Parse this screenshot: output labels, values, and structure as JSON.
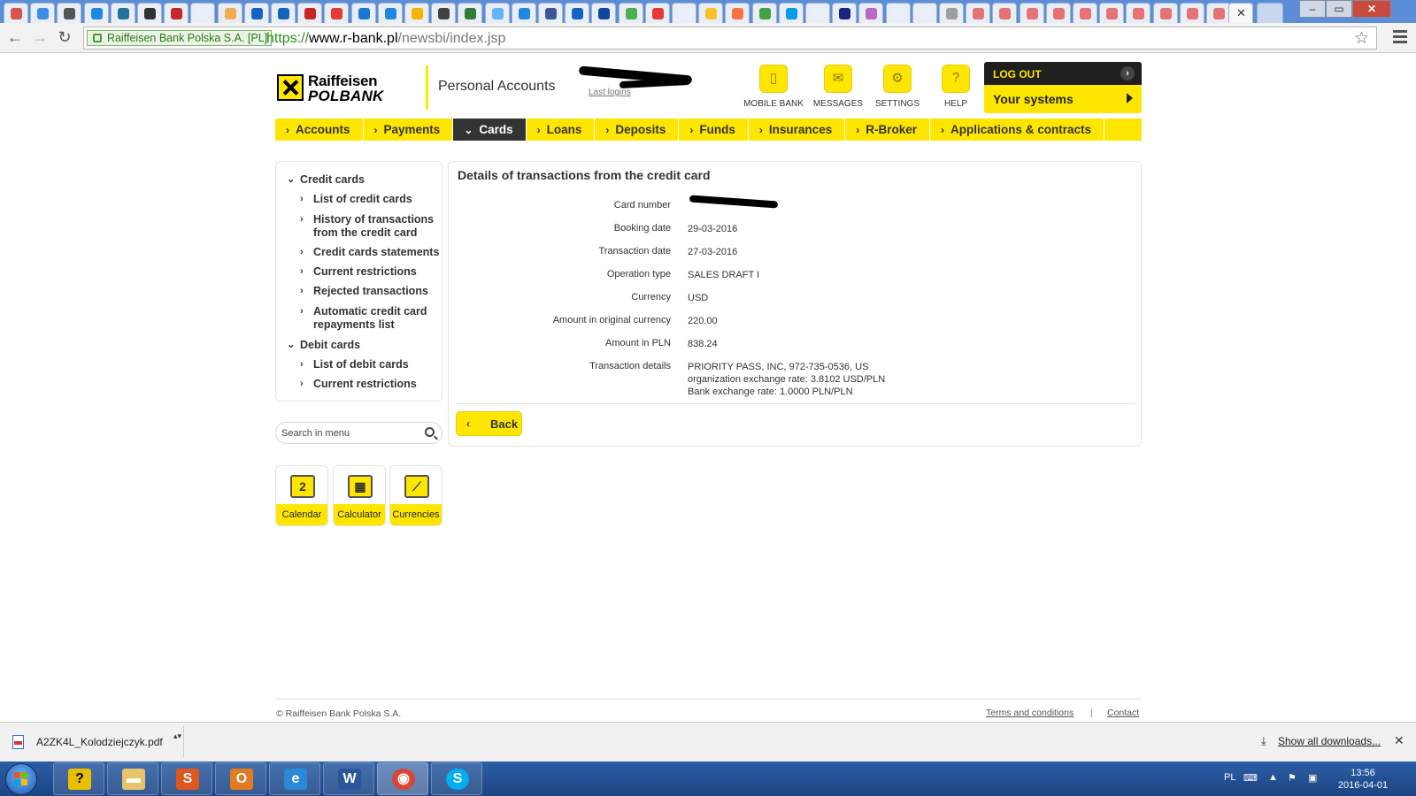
{
  "browser": {
    "ev_label": "Raiffeisen Bank Polska S.A. [PL]",
    "url_scheme": "https://",
    "url_host": "www.r-bank.pl",
    "url_path": "/newsbi/index.jsp",
    "tab_close": "✕"
  },
  "header": {
    "logo_line1": "Raiffeisen",
    "logo_line2": "POLBANK",
    "section_title": "Personal Accounts",
    "last_logins": "Last logins",
    "icons": [
      {
        "label": "MOBILE BANK",
        "icon": "mobile-icon"
      },
      {
        "label": "MESSAGES",
        "icon": "envelope-icon"
      },
      {
        "label": "SETTINGS",
        "icon": "gear-icon"
      },
      {
        "label": "HELP",
        "icon": "help-icon"
      }
    ],
    "logout": "LOG OUT",
    "your_systems": "Your systems"
  },
  "nav": {
    "items": [
      "Accounts",
      "Payments",
      "Cards",
      "Loans",
      "Deposits",
      "Funds",
      "Insurances",
      "R-Broker",
      "Applications & contracts"
    ],
    "active": "Cards"
  },
  "sidebar": {
    "credit_cards": "Credit cards",
    "credit_items": [
      "List of credit cards",
      "History of transactions from the credit card",
      "Credit cards statements",
      "Current restrictions",
      "Rejected transactions",
      "Automatic credit card repayments list"
    ],
    "debit_cards": "Debit cards",
    "debit_items": [
      "List of debit cards",
      "Current restrictions"
    ],
    "search_placeholder": "Search in menu"
  },
  "tools": [
    "Calendar",
    "Calculator",
    "Currencies"
  ],
  "calendar_day": "2",
  "details": {
    "title": "Details of transactions from the credit card",
    "rows": [
      {
        "label": "Card number",
        "value": ""
      },
      {
        "label": "Booking date",
        "value": "29-03-2016"
      },
      {
        "label": "Transaction date",
        "value": "27-03-2016"
      },
      {
        "label": "Operation type",
        "value": "SALES DRAFT I"
      },
      {
        "label": "Currency",
        "value": "USD"
      },
      {
        "label": "Amount in original currency",
        "value": "220.00"
      },
      {
        "label": "Amount in PLN",
        "value": "838.24"
      },
      {
        "label": "Transaction details",
        "value": "PRIORITY PASS, INC, 972-735-0536, US"
      }
    ],
    "detail_line2": "organization exchange rate: 3.8102 USD/PLN",
    "detail_line3": "Bank exchange rate: 1.0000 PLN/PLN",
    "back": "Back"
  },
  "footer": {
    "copyright": "© Raiffeisen Bank Polska S.A.",
    "terms": "Terms and conditions",
    "sep": "|",
    "contact": "Contact"
  },
  "downloads": {
    "file": "A2ZK4L_Kolodziejczyk.pdf",
    "show_all": "Show all downloads..."
  },
  "taskbar": {
    "lang": "PL",
    "time": "13:56",
    "date": "2016-04-01"
  },
  "colors": {
    "brand_yellow": "#ffe600",
    "nav_active": "#333333",
    "logout_bg": "#1f1f1f"
  }
}
